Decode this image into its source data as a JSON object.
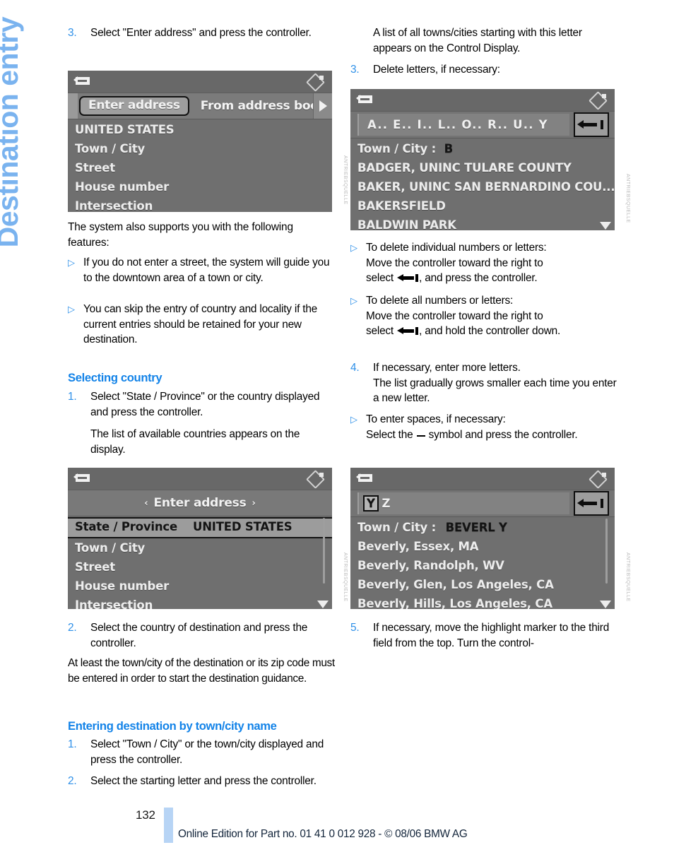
{
  "chapter": {
    "title": "Destination entry"
  },
  "left_column": {
    "step3": {
      "num": "3.",
      "text": "Select \"Enter address\" and press the controller."
    },
    "nav_shot_1": {
      "name": "enter-address-menu",
      "back_icon": "back-arrow-icon",
      "cursor_icon": "idrive-cursor-icon",
      "tab_selected": "Enter address",
      "tab_other": "From address book",
      "tab_more_icon": "triangle-right-icon",
      "rows": [
        "UNITED STATES",
        "Town / City",
        "Street",
        "House number",
        "Intersection"
      ]
    },
    "intro": "The system also supports you with the following features:",
    "bullets": [
      "If you do not enter a street, the system will guide you to the downtown area of a town or city.",
      "You can skip the entry of country and locality if the current entries should be retained for your new destination."
    ],
    "heading_country": "Selecting country",
    "step_c1": {
      "num": "1.",
      "text": "Select \"State / Province\" or the country displayed and press the controller."
    },
    "step_c1_body": "The list of available countries appears on the display.",
    "nav_shot_2": {
      "name": "state-province-menu",
      "back_icon": "back-arrow-icon",
      "cursor_icon": "idrive-cursor-icon",
      "title": "Enter address",
      "arrow_left": "‹",
      "arrow_right": "›",
      "highlight_label": "State / Province",
      "highlight_value": "UNITED STATES",
      "rows": [
        "Town / City",
        "Street",
        "House number",
        "Intersection"
      ],
      "scroll_down_icon": "triangle-down-icon"
    },
    "step_c2": {
      "num": "2.",
      "text": "Select the country of destination and press the controller."
    },
    "note": "At least the town/city of the destination or its zip code must be entered in order to start the destination guidance.",
    "heading_town": "Entering destination by town/city name",
    "step_t1": {
      "num": "1.",
      "text": "Select \"Town / City\" or the town/city displayed and press the controller."
    },
    "step_t2": {
      "num": "2.",
      "text": "Select the starting letter and press the controller."
    }
  },
  "right_column": {
    "lead": "A list of all towns/cities starting with this letter appears on the Control Display.",
    "step3": {
      "num": "3.",
      "text": "Delete letters, if necessary:"
    },
    "nav_shot_3": {
      "name": "town-city-letter-list",
      "back_icon": "back-arrow-icon",
      "cursor_icon": "idrive-cursor-icon",
      "alphabet": "A..  E..  I..  L..  O..  R..  U..  Y",
      "delete_key_icon": "backspace-icon",
      "entry_label": "Town / City :",
      "entry_value": "B",
      "rows": [
        "BADGER, UNINC TULARE COUNTY",
        "BAKER, UNINC SAN BERNARDINO COU...",
        "BAKERSFIELD",
        "BALDWIN PARK"
      ],
      "scroll_down_icon": "triangle-down-icon"
    },
    "bullets": [
      {
        "line1": "To delete individual numbers or letters:",
        "line2": "Move the controller toward the right to",
        "line3_pre": "select ",
        "line3_post": ", and press the controller."
      },
      {
        "line1": "To delete all numbers or letters:",
        "line2": "Move the controller toward the right to",
        "line3_pre": "select ",
        "line3_post": ", and hold the controller down."
      }
    ],
    "step4": {
      "num": "4.",
      "text": "If necessary, enter more letters."
    },
    "step4_body": "The list gradually grows smaller each time you enter a new letter.",
    "bullet_space": {
      "line1": "To enter spaces, if necessary:",
      "line2_pre": "Select the ",
      "line2_post": " symbol and press the controller."
    },
    "nav_shot_4": {
      "name": "town-city-beverly-list",
      "back_icon": "back-arrow-icon",
      "cursor_icon": "idrive-cursor-icon",
      "alpha_selected": "Y",
      "alpha_rest": "Z",
      "delete_key_icon": "backspace-icon",
      "entry_label": "Town / City :",
      "entry_value": "BEVERL Y",
      "rows": [
        "Beverly, Essex, MA",
        "Beverly, Randolph, WV",
        "Beverly, Glen, Los Angeles, CA",
        "Beverly, Hills, Los Angeles, CA"
      ],
      "scroll_down_icon": "triangle-down-icon"
    },
    "step5": {
      "num": "5.",
      "text": "If necessary, move the highlight marker to the third field from the top. Turn the control-"
    }
  },
  "footer": {
    "page_number": "132",
    "note": "Online Edition for Part no. 01 41 0 012 928 - © 08/06 BMW AG"
  },
  "colors": {
    "accent_blue": "#1383e8",
    "number_blue": "#2d8fe8",
    "chapter_blue": "#7ab3ef",
    "footer_bar": "#b7d4f5"
  }
}
